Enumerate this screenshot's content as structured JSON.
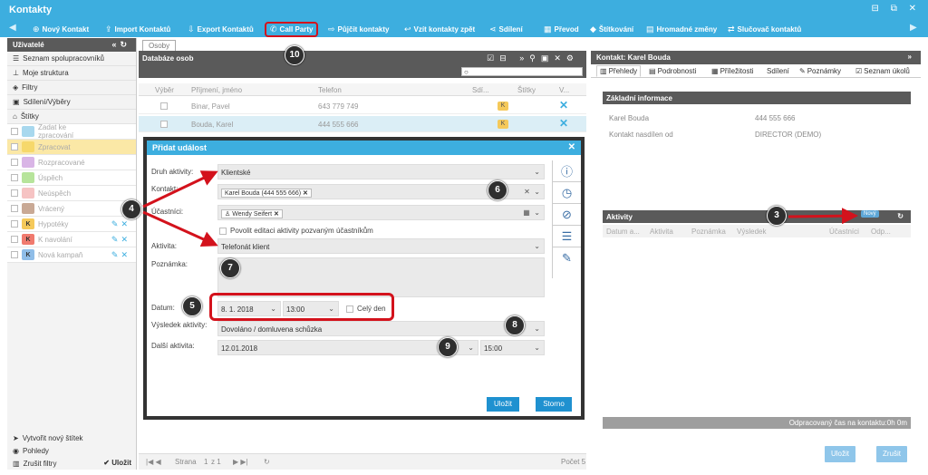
{
  "window": {
    "title": "Kontakty",
    "controls": "⊟ ⧉ ✕"
  },
  "toolbar": {
    "items": [
      {
        "icon": "⊕",
        "label": "Nový Kontakt"
      },
      {
        "icon": "⇪",
        "label": "Import Kontaktů"
      },
      {
        "icon": "⇩",
        "label": "Export Kontaktů"
      },
      {
        "icon": "✆",
        "label": "Call Party"
      },
      {
        "icon": "⇨",
        "label": "Půjčit kontakty"
      },
      {
        "icon": "↩",
        "label": "Vzít kontakty zpět"
      },
      {
        "icon": "⋖",
        "label": "Sdílení"
      },
      {
        "icon": "▦",
        "label": "Převod"
      },
      {
        "icon": "◆",
        "label": "Štítkování"
      },
      {
        "icon": "▤",
        "label": "Hromadné změny"
      },
      {
        "icon": "⇄",
        "label": "Slučovač kontaktů"
      }
    ]
  },
  "sidebar": {
    "header": "Uživatelé",
    "items": [
      "Seznam spolupracovníků",
      "Moje struktura",
      "Filtry",
      "Sdílení/Výběry",
      "Štítky"
    ],
    "tags": [
      {
        "label": "Zadat ke zpracování",
        "color": "#a8d8ee",
        "mark": ""
      },
      {
        "label": "Zpracovat",
        "color": "#f6d86b",
        "mark": "",
        "selected": true
      },
      {
        "label": "Rozpracované",
        "color": "#d9b5e6",
        "mark": ""
      },
      {
        "label": "Úspěch",
        "color": "#b7e49b",
        "mark": ""
      },
      {
        "label": "Neúspěch",
        "color": "#f6c3c3",
        "mark": ""
      },
      {
        "label": "Vrácený",
        "color": "#c9a995",
        "mark": ""
      },
      {
        "label": "Hypotéky",
        "color": "#f5c95a",
        "mark": "K"
      },
      {
        "label": "K navolání",
        "color": "#f07a6e",
        "mark": "K"
      },
      {
        "label": "Nová kampaň",
        "color": "#8fbde8",
        "mark": "K"
      }
    ],
    "footer": {
      "new_tag": "Vytvořit nový štítek",
      "views": "Pohledy",
      "clear": "Zrušit filtry",
      "save": "Uložit"
    }
  },
  "list": {
    "tab": "Osoby",
    "title": "Databáze osob",
    "search_value": "",
    "columns": [
      "Výběr",
      "Příjmení, jméno",
      "Telefon",
      "Sdí...",
      "Štítky",
      "V..."
    ],
    "rows": [
      {
        "name": "Binar, Pavel",
        "phone": "643 779 749"
      },
      {
        "name": "Bouda, Karel",
        "phone": "444 555 666"
      }
    ],
    "pager": {
      "page_label": "Strana",
      "page": "1",
      "of": "z 1",
      "count": "Počet 5"
    }
  },
  "detail": {
    "header": "Kontakt: Karel Bouda",
    "tabs": [
      "Přehledy",
      "Podrobnosti",
      "Příležitosti",
      "Sdílení",
      "Poznámky",
      "Seznam úkolů"
    ],
    "basic": {
      "title": "Základní informace",
      "name": "Karel Bouda",
      "phone": "444 555 666",
      "set_label": "Kontakt nasdílen od",
      "set_value": "DIRECTOR (DEMO)"
    },
    "activities": {
      "title": "Aktivity",
      "new_badge": "Nový",
      "columns": [
        "Datum a...",
        "Aktivita",
        "Poznámka",
        "Výsledek",
        "Účastníci",
        "Odp..."
      ]
    },
    "worked_time": "Odpracovaný čas na kontaktu:0h 0m",
    "save": "Uložit",
    "cancel": "Zrušit"
  },
  "modal": {
    "title": "Přidat událost",
    "labels": {
      "type": "Druh aktivity:",
      "contact": "Kontakt:",
      "participants": "Účastníci:",
      "activity": "Aktivita:",
      "note": "Poznámka:",
      "date": "Datum:",
      "result": "Výsledek aktivity:",
      "next": "Další aktivita:"
    },
    "values": {
      "type": "Klientské",
      "contact_chip": "Karel Bouda (444 555 666)",
      "participant_chip": "Wendy Seifert",
      "allow_edit": "Povolit editaci aktivity pozvaným účastníkům",
      "activity": "Telefonát klient",
      "date": "8. 1. 2018",
      "time": "13:00",
      "all_day": "Celý den",
      "result": "Dovoláno / domluvena schůzka",
      "next_date": "12.01.2018",
      "next_time": "15:00"
    },
    "save": "Uložit",
    "cancel": "Storno"
  },
  "annotations": [
    "3",
    "4",
    "5",
    "6",
    "7",
    "8",
    "9",
    "10"
  ],
  "colors": {
    "accent": "#3daedf",
    "annotation_red": "#d3121c",
    "annotation_badge": "#2f2f2f"
  }
}
